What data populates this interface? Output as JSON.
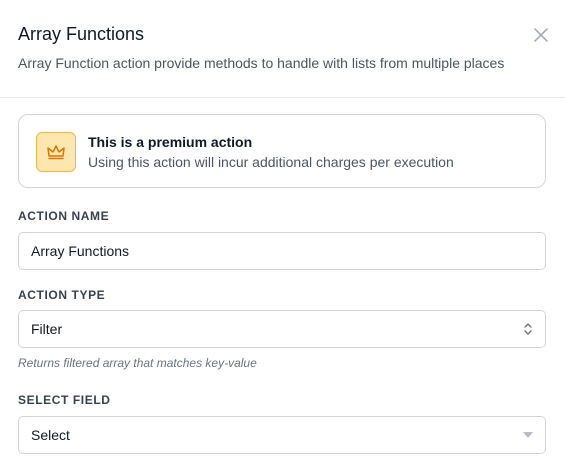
{
  "modal": {
    "title": "Array Functions",
    "subtitle": "Array Function action provide methods to handle with lists from multiple places",
    "close_icon": "close-icon"
  },
  "premium": {
    "icon": "crown-icon",
    "title": "This is a premium action",
    "description": "Using this action will incur additional charges per execution"
  },
  "action_name": {
    "label": "ACTION NAME",
    "value": "Array Functions"
  },
  "action_type": {
    "label": "ACTION TYPE",
    "value": "Filter",
    "hint": "Returns filtered array that matches key-value",
    "icon": "chevron-up-down-icon"
  },
  "select_field": {
    "label": "SELECT FIELD",
    "value": "Select",
    "icon": "caret-down-icon"
  },
  "colors": {
    "premium_bg": "#fde7b0",
    "premium_border": "#f2b84b",
    "premium_icon": "#d97706"
  }
}
